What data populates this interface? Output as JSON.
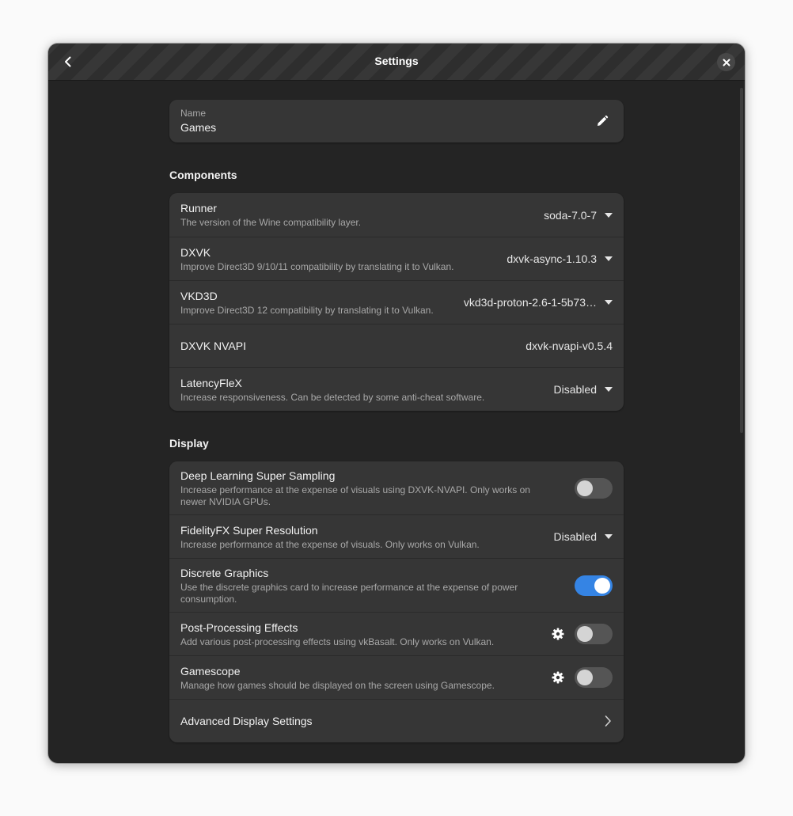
{
  "header": {
    "title": "Settings",
    "back_icon": "go-back-icon",
    "close_icon": "close-icon"
  },
  "name_card": {
    "label": "Name",
    "value": "Games",
    "edit_icon": "pencil-icon"
  },
  "components": {
    "title": "Components",
    "runner": {
      "title": "Runner",
      "subtitle": "The version of the Wine compatibility layer.",
      "value": "soda-7.0-7"
    },
    "dxvk": {
      "title": "DXVK",
      "subtitle": "Improve Direct3D 9/10/11 compatibility by translating it to Vulkan.",
      "value": "dxvk-async-1.10.3"
    },
    "vkd3d": {
      "title": "VKD3D",
      "subtitle": "Improve Direct3D 12 compatibility by translating it to Vulkan.",
      "value": "vkd3d-proton-2.6-1-5b73…"
    },
    "nvapi": {
      "title": "DXVK NVAPI",
      "value": "dxvk-nvapi-v0.5.4"
    },
    "latencyflex": {
      "title": "LatencyFleX",
      "subtitle": "Increase responsiveness. Can be detected by some anti-cheat software.",
      "value": "Disabled"
    }
  },
  "display": {
    "title": "Display",
    "dlss": {
      "title": "Deep Learning Super Sampling",
      "subtitle": "Increase performance at the expense of visuals using DXVK-NVAPI. Only works on newer NVIDIA GPUs.",
      "enabled": false
    },
    "fsr": {
      "title": "FidelityFX Super Resolution",
      "subtitle": "Increase performance at the expense of visuals. Only works on Vulkan.",
      "value": "Disabled"
    },
    "discrete": {
      "title": "Discrete Graphics",
      "subtitle": "Use the discrete graphics card to increase performance at the expense of power consumption.",
      "enabled": true
    },
    "postprocessing": {
      "title": "Post-Processing Effects",
      "subtitle": "Add various post-processing effects using vkBasalt. Only works on Vulkan.",
      "enabled": false
    },
    "gamescope": {
      "title": "Gamescope",
      "subtitle": "Manage how games should be displayed on the screen using Gamescope.",
      "enabled": false
    },
    "advanced": {
      "title": "Advanced Display Settings"
    }
  },
  "colors": {
    "accent": "#3584e4",
    "window_bg": "#242424",
    "card_bg": "#363636"
  }
}
